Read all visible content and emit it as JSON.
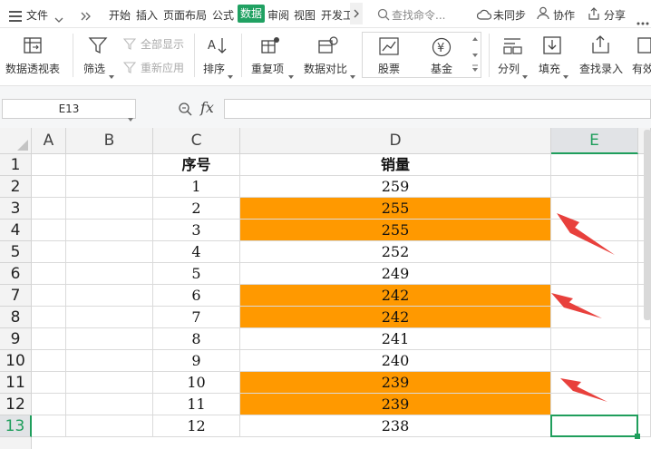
{
  "topbar": {
    "file_menu": "文件",
    "tabs": [
      "开始",
      "插入",
      "页面布局",
      "公式",
      "数据",
      "审阅",
      "视图",
      "开发工"
    ],
    "active_tab": "数据",
    "search_placeholder": "查找命令...",
    "sync": "未同步",
    "collab": "协作",
    "share": "分享"
  },
  "ribbon": {
    "pivot": "数据透视表",
    "filter": "筛选",
    "show_all": "全部显示",
    "reapply": "重新应用",
    "sort": "排序",
    "duplicates": "重复项",
    "compare": "数据对比",
    "stocks": "股票",
    "funds": "基金",
    "split": "分列",
    "fill": "填充",
    "lookup": "查找录入",
    "valid": "有效"
  },
  "formula_bar": {
    "name_box": "E13",
    "fx": "fx",
    "value": ""
  },
  "sheet": {
    "columns": [
      "A",
      "B",
      "C",
      "D",
      "E"
    ],
    "selected_column": "E",
    "rows": [
      {
        "r": "1",
        "c": "序号",
        "d": "销量"
      },
      {
        "r": "2",
        "c": "1",
        "d": "259"
      },
      {
        "r": "3",
        "c": "2",
        "d": "255"
      },
      {
        "r": "4",
        "c": "3",
        "d": "255"
      },
      {
        "r": "5",
        "c": "4",
        "d": "252"
      },
      {
        "r": "6",
        "c": "5",
        "d": "249"
      },
      {
        "r": "7",
        "c": "6",
        "d": "242"
      },
      {
        "r": "8",
        "c": "7",
        "d": "242"
      },
      {
        "r": "9",
        "c": "8",
        "d": "241"
      },
      {
        "r": "10",
        "c": "9",
        "d": "240"
      },
      {
        "r": "11",
        "c": "10",
        "d": "239"
      },
      {
        "r": "12",
        "c": "11",
        "d": "239"
      },
      {
        "r": "13",
        "c": "12",
        "d": "238"
      }
    ],
    "highlight_color": "#ff9900",
    "selection_color": "#1f9e5c",
    "annotation_color": "#e8403c"
  }
}
